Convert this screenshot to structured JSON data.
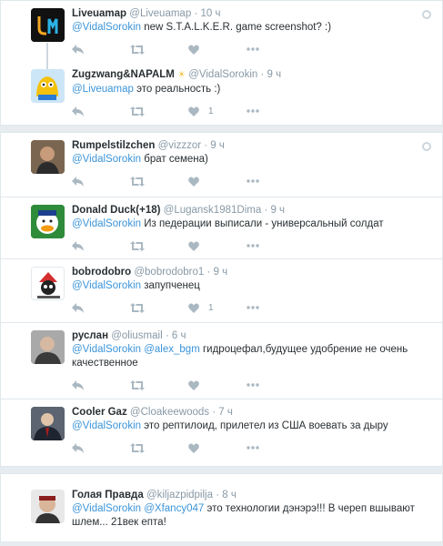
{
  "groups": [
    {
      "tweets": [
        {
          "name": "Liveuamap",
          "handle": "@Liveuamap",
          "time": "10 ч",
          "mention": "@VidalSorokin",
          "text": " new S.T.A.L.K.E.R. game screenshot?  :)",
          "likes": ""
        },
        {
          "name": "Zugzwang&NAPALM",
          "handle": "@VidalSorokin",
          "time": "9 ч",
          "mention": "@Liveuamap",
          "text": " это реальность :)",
          "likes": "1"
        }
      ]
    },
    {
      "tweets": [
        {
          "name": "Rumpelstilzchen",
          "handle": "@vizzzor",
          "time": "9 ч",
          "mention": "@VidalSorokin",
          "text": " брат семена)",
          "likes": ""
        },
        {
          "name": "Donald Duck(+18)",
          "handle": "@Lugansk1981Dima",
          "time": "9 ч",
          "mention": "@VidalSorokin",
          "text": " Из педерации выписали - универсальный солдат",
          "likes": ""
        },
        {
          "name": "bobrodobro",
          "handle": "@bobrodobro1",
          "time": "9 ч",
          "mention": "@VidalSorokin",
          "text": " запупченец",
          "likes": "1"
        },
        {
          "name": "руслан",
          "handle": "@oliusmail",
          "time": "6 ч",
          "mention": "@VidalSorokin",
          "mention2": "@alex_bgm",
          "text": " гидроцефал,будущее удобрение не очень качественное",
          "likes": ""
        },
        {
          "name": "Cooler Gaz",
          "handle": "@Cloakeewoods",
          "time": "7 ч",
          "mention": "@VidalSorokin",
          "text": " это рептилоид, прилетел из США воевать за дыру",
          "likes": ""
        }
      ]
    },
    {
      "tweets": [
        {
          "name": "Голая Правда",
          "handle": "@kiljazpidpilja",
          "time": "8 ч",
          "mention": "@VidalSorokin",
          "mention2": "@Xfancy047",
          "text": " это технологии дэнэрэ!!! В череп вшывают шлем... 21век епта!",
          "likes": ""
        }
      ]
    }
  ],
  "colors": {
    "link": "#3b94d9",
    "muted": "#8899a6",
    "icon": "#aab8c2",
    "bg": "#e6ecf0"
  },
  "icons": [
    "reply-icon",
    "retweet-icon",
    "like-icon",
    "more-icon",
    "settings-icon"
  ]
}
